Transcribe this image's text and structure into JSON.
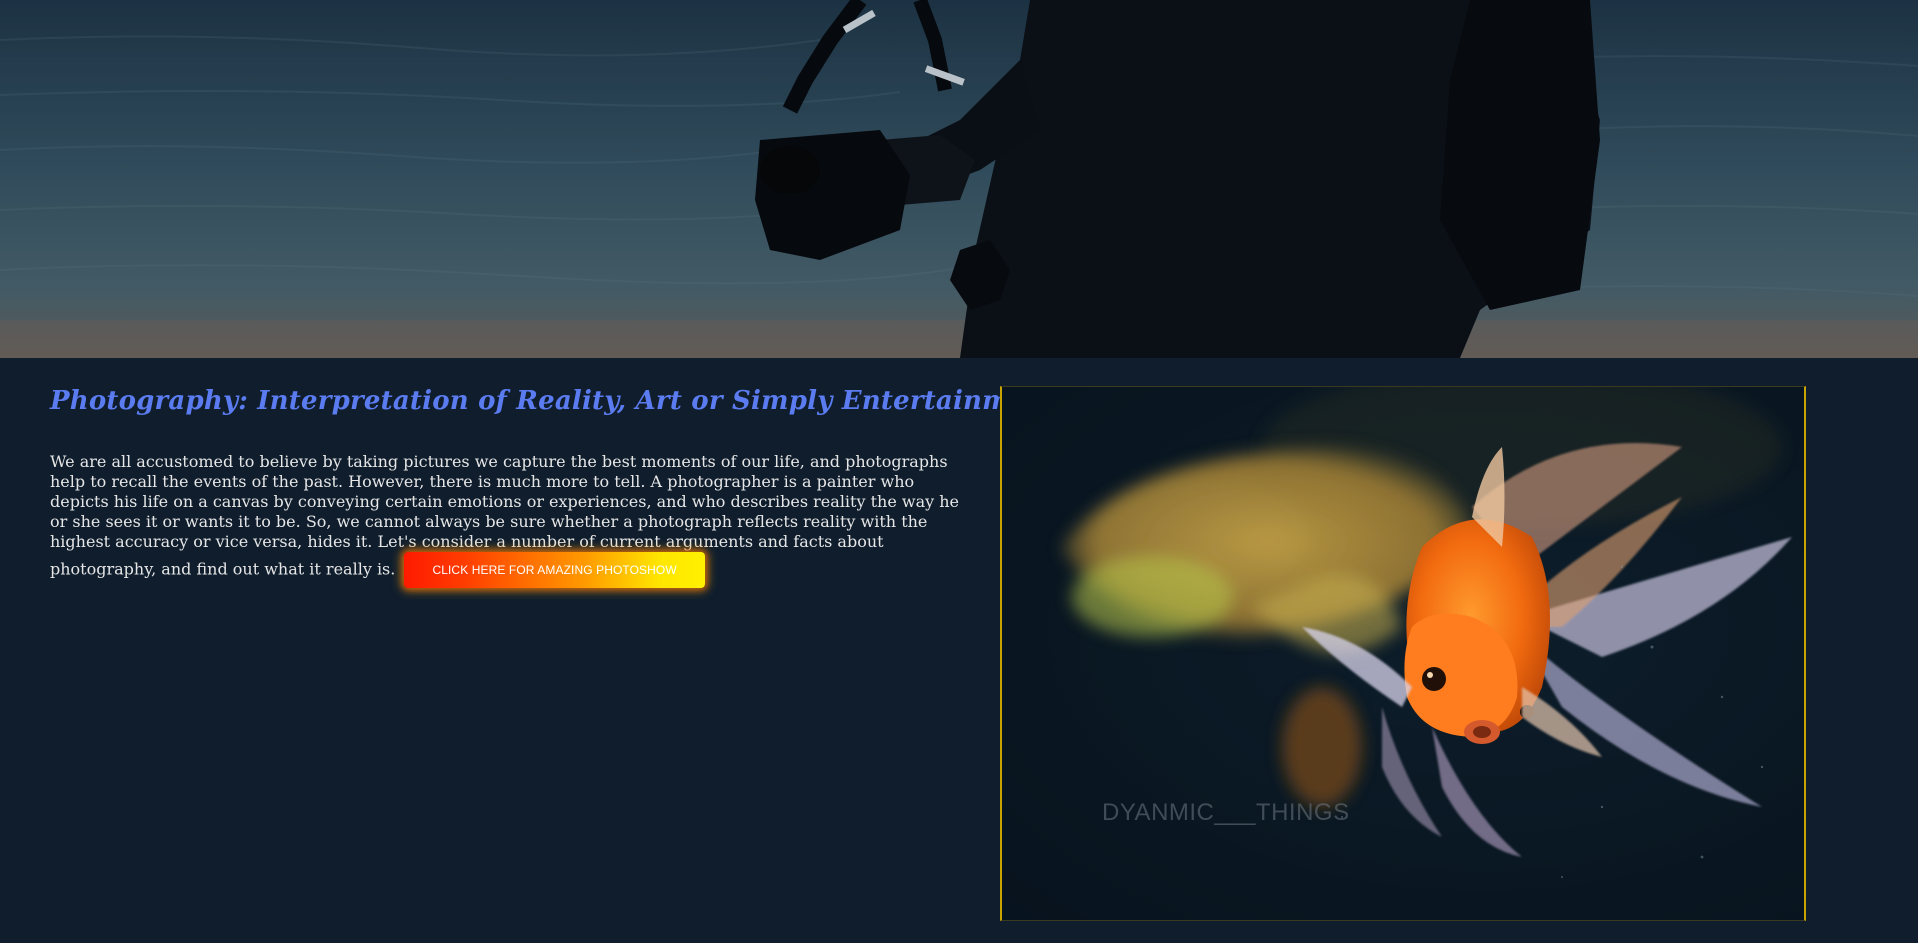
{
  "hero": {
    "image": "photographer-silhouette-at-lake"
  },
  "article": {
    "title": "Photography: Interpretation of Reality, Art or Simply Entertainment?",
    "body": "We are all accustomed to believe by taking pictures we capture the best moments of our life, and photographs help to recall the events of the past. However, there is much more to tell. A photographer is a painter who depicts his life on a canvas by conveying certain emotions or experiences, and who describes reality the way he or she sees it or wants it to be. So, we cannot always be sure whether a photograph reflects reality with the highest accuracy or vice versa, hides it. Let's consider a number of current arguments and facts about photography, and find out what it really is.",
    "button_label": "CLICK HERE FOR AMAZING PHOTOSHOW"
  },
  "feature_image": {
    "image": "goldfish-photo",
    "watermark": "DYANMIC___THINGS"
  },
  "colors": {
    "page_background": "#0f1d2d",
    "title": "#5b7cf0",
    "body_text": "#e6e6e6",
    "frame_border": "#c9a400",
    "button_gradient_start": "#ff1a00",
    "button_gradient_end": "#fff000"
  }
}
